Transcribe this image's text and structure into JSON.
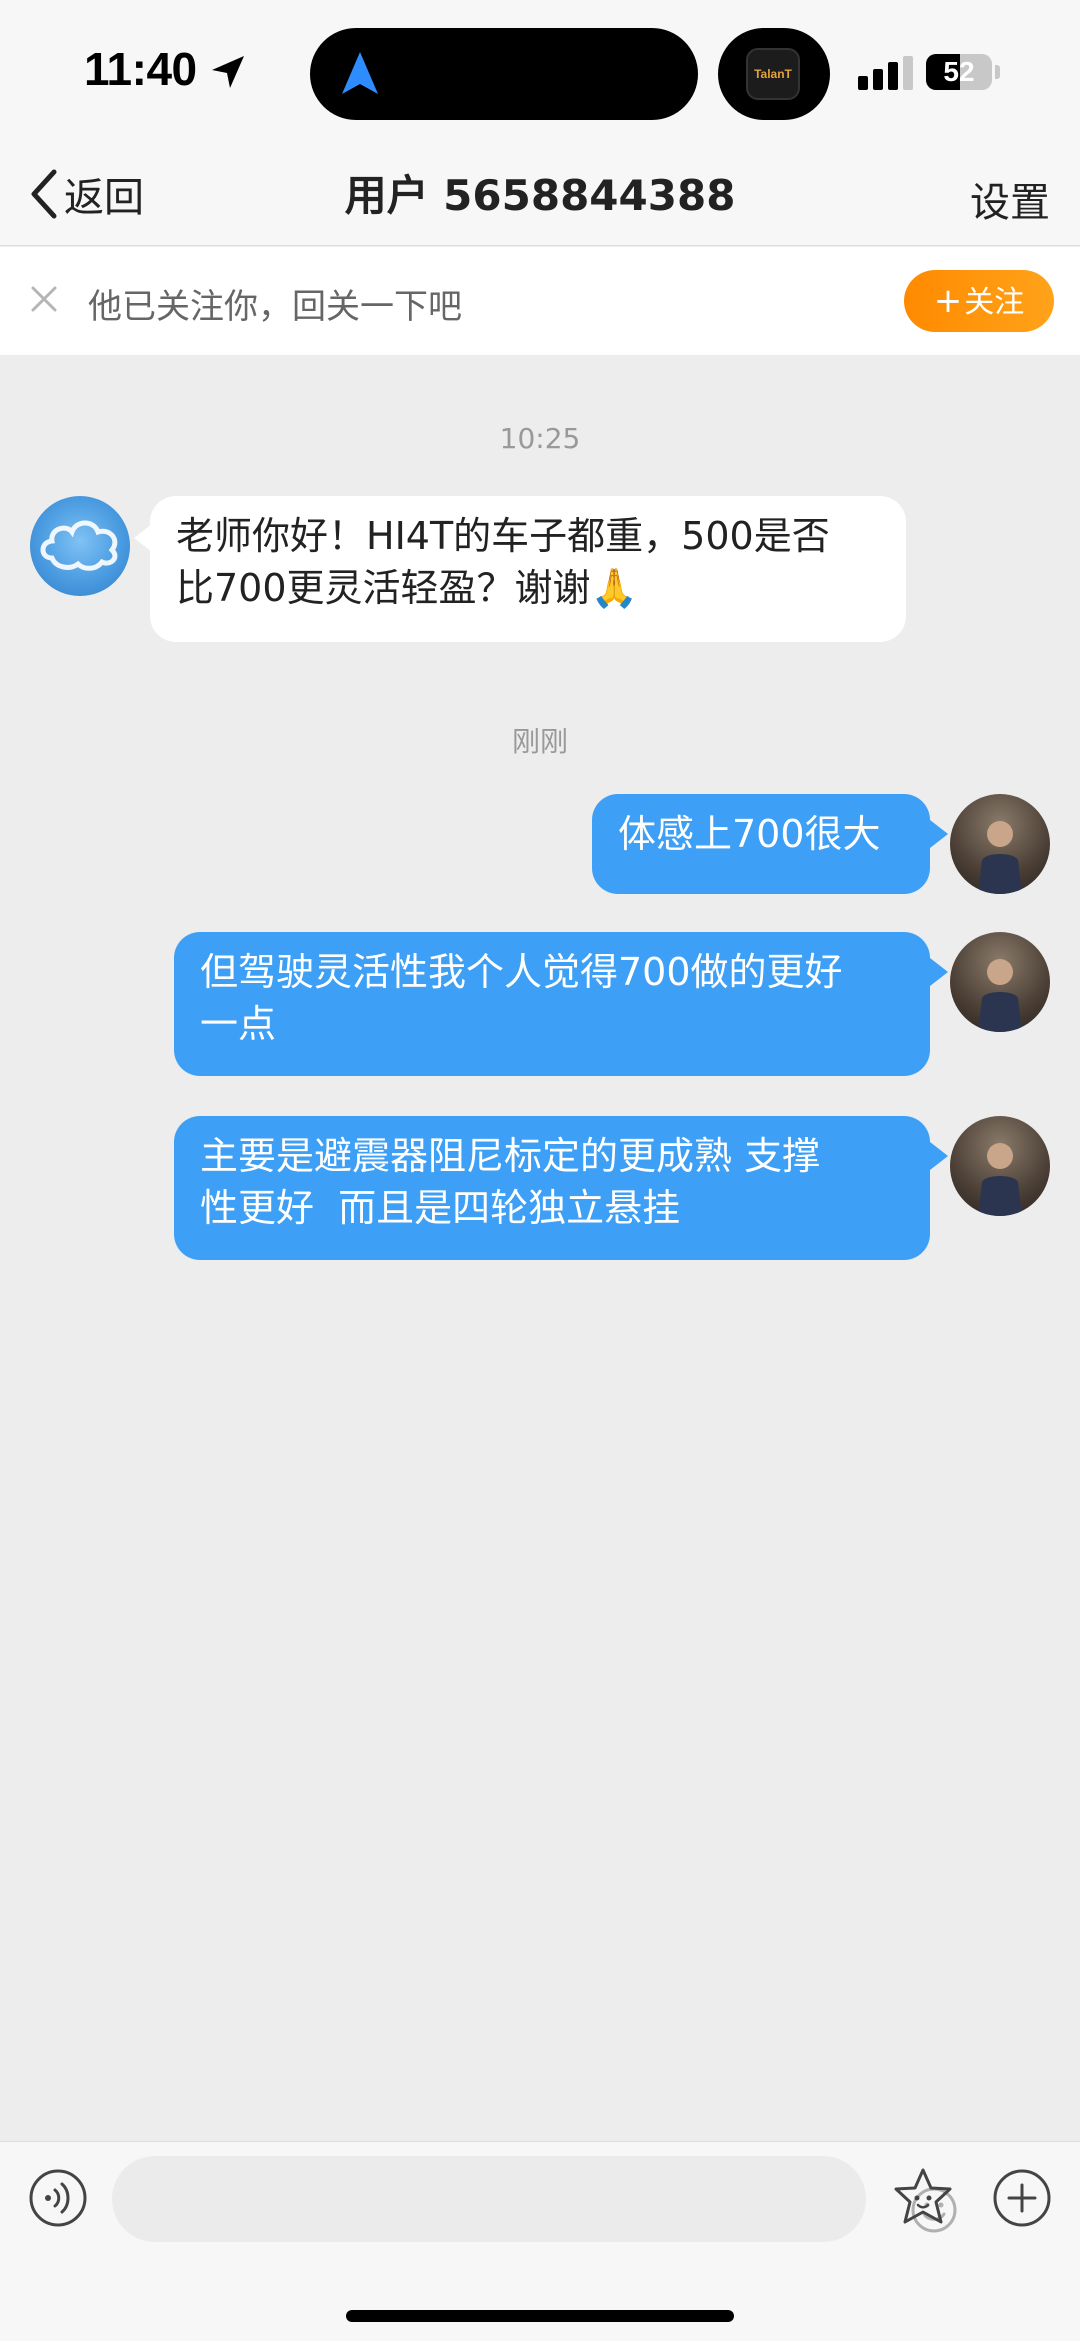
{
  "status_bar": {
    "time": "11:40",
    "battery_level": 52,
    "battery_text": "52",
    "island_app_label": "TalanT"
  },
  "nav": {
    "back_label": "返回",
    "title": "用户 5658844388",
    "settings_label": "设置"
  },
  "follow_banner": {
    "text": "他已关注你，回关一下吧",
    "button_plus": "+",
    "button_label": "关注"
  },
  "chat": {
    "timestamps": [
      "10:25",
      "刚刚"
    ],
    "messages": [
      {
        "from": "other",
        "lines": [
          "老师你好！HI4T的车子都重，500是否",
          "比700更灵活轻盈？谢谢🙏"
        ]
      },
      {
        "from": "me",
        "lines": [
          "体感上700很大"
        ]
      },
      {
        "from": "me",
        "lines": [
          "但驾驶灵活性我个人觉得700做的更好",
          "一点"
        ]
      },
      {
        "from": "me",
        "lines": [
          "主要是避震器阻尼标定的更成熟 支撑",
          "性更好  而且是四轮独立悬挂"
        ]
      }
    ]
  },
  "colors": {
    "outgoing_bubble": "#3d9ff5",
    "incoming_bubble": "#ffffff",
    "follow_button": "#ff9500",
    "background": "#ededed"
  },
  "input_bar": {
    "icons": [
      "voice-icon",
      "emoji-icon",
      "sticker-icon",
      "plus-icon"
    ]
  }
}
